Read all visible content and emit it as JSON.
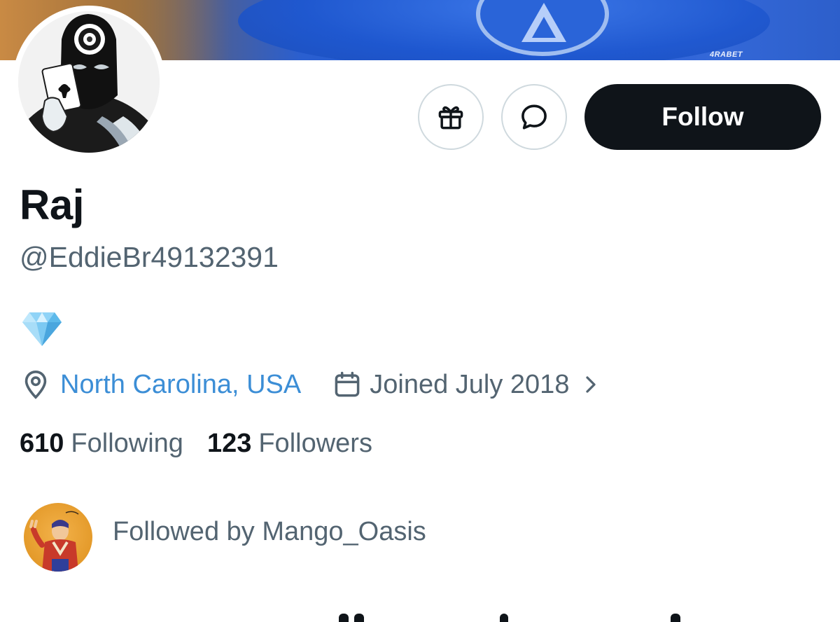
{
  "banner": {
    "sponsor_text": "4RABET"
  },
  "profile": {
    "display_name": "Raj",
    "handle": "@EddieBr49132391",
    "bio_emoji": "gem-stone-icon",
    "location": "North Carolina, USA",
    "joined": "Joined July 2018",
    "following_count": "610",
    "following_label": "Following",
    "followers_count": "123",
    "followers_label": "Followers",
    "followed_by": "Followed by Mango_Oasis"
  },
  "actions": {
    "follow_label": "Follow",
    "gift_icon": "gift-icon",
    "message_icon": "message-bubble-icon"
  },
  "colors": {
    "primary_text": "#0f1419",
    "secondary_text": "#536471",
    "link": "#3c8ed6",
    "follow_bg": "#0f1419",
    "border": "#cfd9de"
  }
}
